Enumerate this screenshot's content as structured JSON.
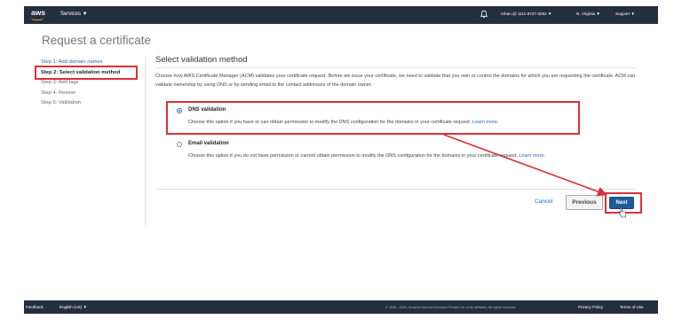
{
  "nav": {
    "logo": "aws",
    "services": "Services ▼",
    "account": "rohan @ 1111-6727-3292 ▼",
    "region": "N. Virginia ▼",
    "support": "Support ▼"
  },
  "page": {
    "title": "Request a certificate"
  },
  "steps": [
    {
      "label": "Step 1: Add domain names",
      "state": "link"
    },
    {
      "label": "Step 2: Select validation method",
      "state": "active"
    },
    {
      "label": "Step 3: Add tags",
      "state": "pending"
    },
    {
      "label": "Step 4: Review",
      "state": "pending"
    },
    {
      "label": "Step 5: Validation",
      "state": "pending"
    }
  ],
  "main": {
    "section_title": "Select validation method",
    "description": "Choose how AWS Certificate Manager (ACM) validates your certificate request. Before we issue your certificate, we need to validate that you own or control the domains for which you are requesting the certificate. ACM can validate ownership by using DNS or by sending email to the contact addresses of the domain owner.",
    "dns": {
      "title": "DNS validation",
      "text": "Choose this option if you have or can obtain permission to modify the DNS configuration for the domains in your certificate request.",
      "learn_more": "Learn more.",
      "selected": true
    },
    "email": {
      "title": "Email validation",
      "text": "Choose this option if you do not have permission or cannot obtain permission to modify the DNS configuration for the domains in your certificate request.",
      "learn_more": "Learn more.",
      "selected": false
    }
  },
  "actions": {
    "cancel": "Cancel",
    "previous": "Previous",
    "next": "Next"
  },
  "footer": {
    "feedback": "Feedback",
    "language": "English (US) ▼",
    "copyright": "© 2008 - 2020, Amazon Internet Services Private Ltd. or its affiliates. All rights reserved.",
    "privacy": "Privacy Policy",
    "terms": "Terms of Use"
  },
  "colors": {
    "nav_bg": "#232f3e",
    "accent": "#ff9900",
    "link": "#2a6ab0",
    "primary_button": "#1f5c99",
    "highlight": "#d9313a"
  },
  "icons": {
    "bell": "bell-icon",
    "cursor": "hand-cursor-icon"
  }
}
